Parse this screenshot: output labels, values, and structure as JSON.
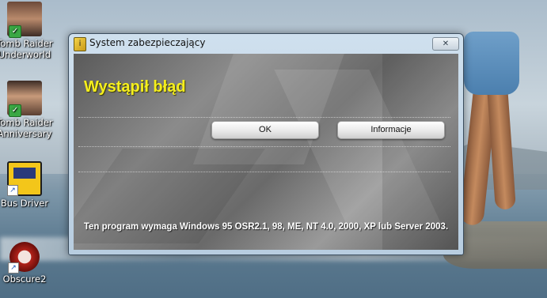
{
  "desktop": {
    "icons": [
      {
        "label_line1": "Tomb Raider",
        "label_line2": "Underworld",
        "icon": "tomb-raider-underworld-icon"
      },
      {
        "label_line1": "Tomb Raider",
        "label_line2": "Anniversary",
        "icon": "tomb-raider-anniversary-icon"
      },
      {
        "label_line1": "Bus Driver",
        "label_line2": "",
        "icon": "bus-driver-icon"
      },
      {
        "label_line1": "Obscure2",
        "label_line2": "",
        "icon": "obscure2-icon"
      }
    ]
  },
  "dialog": {
    "title": "System zabezpieczający",
    "close_glyph": "✕",
    "headline": "Wystąpił błąd",
    "ok_label": "OK",
    "info_label": "Informacje",
    "message": "Ten program wymaga Windows 95 OSR2.1, 98, ME, NT 4.0, 2000, XP lub Server 2003.",
    "headline_color": "#f6ef1d"
  }
}
